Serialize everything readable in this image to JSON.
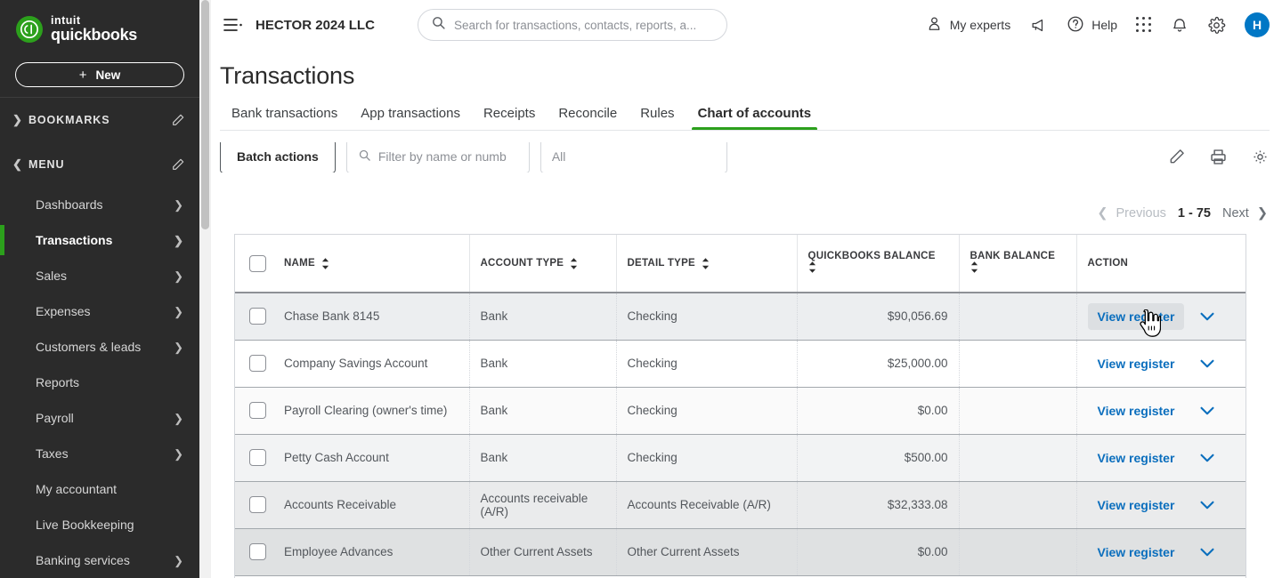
{
  "brand": {
    "intuit": "intuit",
    "product": "quickbooks",
    "new_button": "New",
    "plus": "+"
  },
  "sidebar": {
    "sections": [
      {
        "label": "BOOKMARKS",
        "expanded": false
      },
      {
        "label": "MENU",
        "expanded": true
      }
    ],
    "items": [
      {
        "label": "Dashboards",
        "chevron": true,
        "active": false
      },
      {
        "label": "Transactions",
        "chevron": true,
        "active": true
      },
      {
        "label": "Sales",
        "chevron": true,
        "active": false
      },
      {
        "label": "Expenses",
        "chevron": true,
        "active": false
      },
      {
        "label": "Customers & leads",
        "chevron": true,
        "active": false
      },
      {
        "label": "Reports",
        "chevron": false,
        "active": false
      },
      {
        "label": "Payroll",
        "chevron": true,
        "active": false
      },
      {
        "label": "Taxes",
        "chevron": true,
        "active": false
      },
      {
        "label": "My accountant",
        "chevron": false,
        "active": false
      },
      {
        "label": "Live Bookkeeping",
        "chevron": false,
        "active": false
      },
      {
        "label": "Banking services",
        "chevron": true,
        "active": false
      }
    ]
  },
  "topbar": {
    "company": "HECTOR 2024 LLC",
    "search_placeholder": "Search for transactions, contacts, reports, a...",
    "my_experts": "My experts",
    "help": "Help",
    "avatar_initial": "H"
  },
  "page": {
    "title": "Transactions"
  },
  "tabs": [
    {
      "label": "Bank transactions",
      "active": false
    },
    {
      "label": "App transactions",
      "active": false
    },
    {
      "label": "Receipts",
      "active": false
    },
    {
      "label": "Reconcile",
      "active": false
    },
    {
      "label": "Rules",
      "active": false
    },
    {
      "label": "Chart of accounts",
      "active": true
    }
  ],
  "toolbar": {
    "batch_actions": "Batch actions",
    "filter_placeholder": "Filter by name or numb",
    "select_value": "All"
  },
  "pagination": {
    "previous": "Previous",
    "range": "1 - 75",
    "next": "Next"
  },
  "table": {
    "columns": [
      {
        "label": "NAME",
        "sortable": true
      },
      {
        "label": "ACCOUNT TYPE",
        "sortable": true
      },
      {
        "label": "DETAIL TYPE",
        "sortable": true
      },
      {
        "label": "QUICKBOOKS BALANCE",
        "sortable": true
      },
      {
        "label": "BANK BALANCE",
        "sortable": true
      },
      {
        "label": "ACTION",
        "sortable": false
      }
    ],
    "action_label": "View register",
    "rows": [
      {
        "name": "Chase Bank 8145",
        "account_type": "Bank",
        "detail_type": "Checking",
        "quickbooks_balance": "$90,056.69",
        "bank_balance": "",
        "hovered": true
      },
      {
        "name": "Company Savings Account",
        "account_type": "Bank",
        "detail_type": "Checking",
        "quickbooks_balance": "$25,000.00",
        "bank_balance": "",
        "hovered": false
      },
      {
        "name": "Payroll Clearing (owner's time)",
        "account_type": "Bank",
        "detail_type": "Checking",
        "quickbooks_balance": "$0.00",
        "bank_balance": "",
        "hovered": false
      },
      {
        "name": "Petty Cash Account",
        "account_type": "Bank",
        "detail_type": "Checking",
        "quickbooks_balance": "$500.00",
        "bank_balance": "",
        "hovered": false
      },
      {
        "name": "Accounts Receivable",
        "account_type": "Accounts receivable (A/R)",
        "detail_type": "Accounts Receivable (A/R)",
        "quickbooks_balance": "$32,333.08",
        "bank_balance": "",
        "hovered": false
      },
      {
        "name": "Employee Advances",
        "account_type": "Other Current Assets",
        "detail_type": "Other Current Assets",
        "quickbooks_balance": "$0.00",
        "bank_balance": "",
        "hovered": false
      }
    ]
  },
  "colors": {
    "brand_green": "#2ca01c",
    "link_blue": "#0a6ebd",
    "avatar_blue": "#0077c5",
    "sidebar_bg": "#2b2b2b"
  }
}
